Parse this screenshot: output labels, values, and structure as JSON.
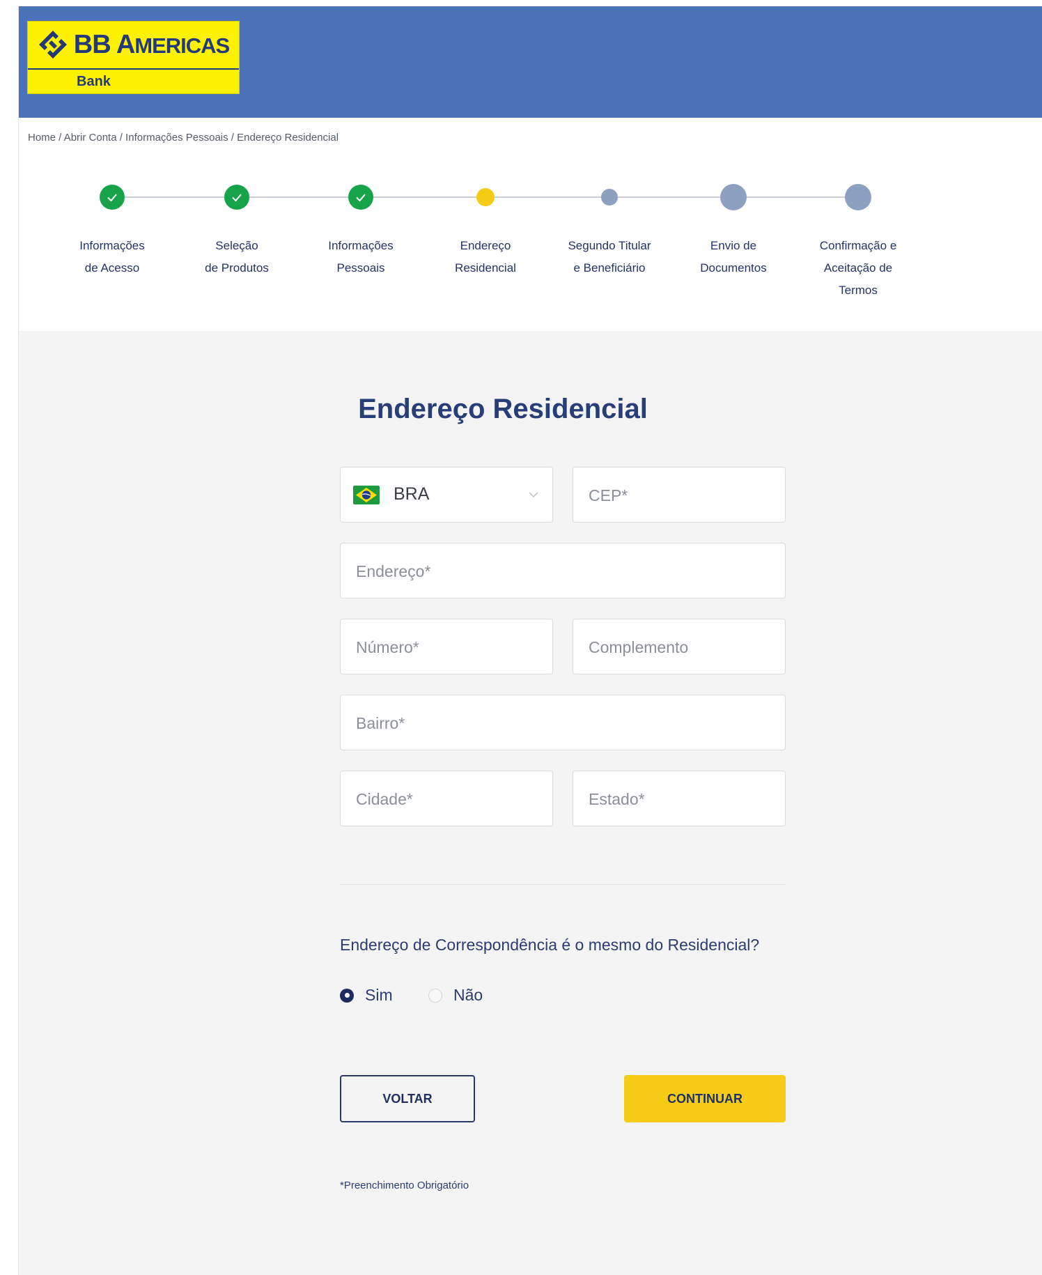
{
  "brand": {
    "name_part1": "BB",
    "name_part2_first": "A",
    "name_part2_rest": "MERICAS",
    "sub": "Bank",
    "logo_icon": "bb-logo-icon",
    "colors": {
      "header": "#4b71b8",
      "logo_bg": "#fff200",
      "logo_text": "#233a7a"
    }
  },
  "breadcrumb": "Home / Abrir Conta / Informações Pessoais / Endereço Residencial",
  "steps": [
    {
      "line1": "Informações",
      "line2": "de Acesso",
      "line3": "",
      "status": "done"
    },
    {
      "line1": "Seleção",
      "line2": "de Produtos",
      "line3": "",
      "status": "done"
    },
    {
      "line1": "Informações",
      "line2": "Pessoais",
      "line3": "",
      "status": "done"
    },
    {
      "line1": "Endereço",
      "line2": "Residencial",
      "line3": "",
      "status": "current"
    },
    {
      "line1": "Segundo Titular",
      "line2": "e Beneficiário",
      "line3": "",
      "status": "pending"
    },
    {
      "line1": "Envio de",
      "line2": "Documentos",
      "line3": "",
      "status": "pending"
    },
    {
      "line1": "Confirmação e",
      "line2": "Aceitação de",
      "line3": "Termos",
      "status": "pending"
    }
  ],
  "form": {
    "title": "Endereço Residencial",
    "country": {
      "value": "BRA",
      "flag": "brazil-flag-icon"
    },
    "cep": {
      "placeholder": "CEP*",
      "value": ""
    },
    "endereco": {
      "placeholder": "Endereço*",
      "value": ""
    },
    "numero": {
      "placeholder": "Número*",
      "value": ""
    },
    "complemento": {
      "placeholder": "Complemento",
      "value": ""
    },
    "bairro": {
      "placeholder": "Bairro*",
      "value": ""
    },
    "cidade": {
      "placeholder": "Cidade*",
      "value": ""
    },
    "estado": {
      "placeholder": "Estado*",
      "value": ""
    }
  },
  "mailing": {
    "question": "Endereço de Correspondência é o mesmo do Residencial?",
    "option_yes": "Sim",
    "option_no": "Não",
    "selected": "Sim"
  },
  "buttons": {
    "back": "VOLTAR",
    "next": "CONTINUAR"
  },
  "note": "*Preenchimento Obrigatório",
  "colors": {
    "done": "#17a34a",
    "current": "#f6cd16",
    "pending": "#8ea0bf",
    "primary_button": "#f7cc17",
    "title": "#273e78"
  }
}
